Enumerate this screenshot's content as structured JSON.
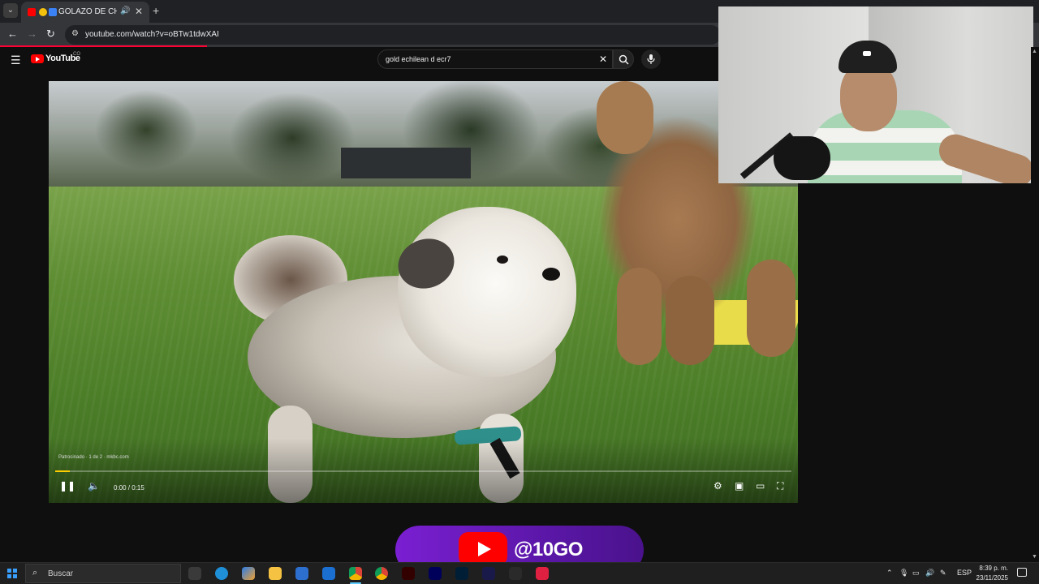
{
  "browser": {
    "tab": {
      "title": "GOLAZO DE CHILEN",
      "close_label": "✕",
      "audio_icon": "speaker-icon"
    },
    "new_tab_label": "+",
    "tab_menu_label": "⌄",
    "url": "youtube.com/watch?v=oBTw1tdwXAI",
    "back_label": "←",
    "forward_label": "→",
    "reload_label": "↻",
    "site_icon_label": "⚙"
  },
  "youtube": {
    "logo_text": "YouTube",
    "country_code": "CO",
    "search_query": "gold echilean d ecr7",
    "clear_label": "✕"
  },
  "player": {
    "overlay_text": "Patrocinado · 1 de 2 · mkbc.com",
    "current_time": "0:00",
    "duration": "0:15",
    "time_display": "0:00 / 0:15",
    "progress": 0.02,
    "progress_color": "#ffcc00"
  },
  "badge": {
    "handle": "@10GO"
  },
  "taskbar": {
    "search_placeholder": "Buscar",
    "language": "ESP",
    "time": "8:39 p. m.",
    "date": "23/11/2025"
  },
  "colors": {
    "youtube_red": "#ff0000",
    "badge_purple": "#6a1bbf",
    "page_bg": "#0f0f0f"
  }
}
